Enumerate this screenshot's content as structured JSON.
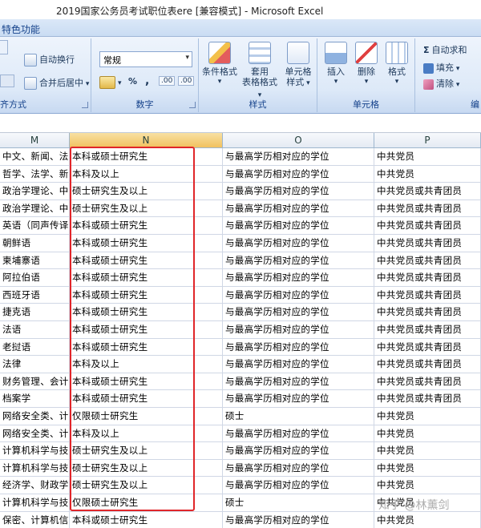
{
  "window": {
    "title": "2019国家公务员考试职位表ere  [兼容模式] - Microsoft Excel"
  },
  "ribbon": {
    "tab_label": "特色功能",
    "alignment": {
      "label": "齐方式",
      "wrap_text": "自动换行",
      "merge_center": "合并后居中"
    },
    "number": {
      "label": "数字",
      "format_value": "常规",
      "percent": "%",
      "comma": ",",
      "inc_decimal": ".00",
      "dec_decimal": ".00"
    },
    "styles": {
      "label": "样式",
      "conditional": [
        "条件格式"
      ],
      "table_format": [
        "套用",
        "表格格式"
      ],
      "cell_styles": [
        "单元格",
        "样式"
      ]
    },
    "cells": {
      "label": "单元格",
      "insert": "插入",
      "delete": "删除",
      "format": "格式"
    },
    "editing": {
      "label": "编",
      "autosum": "自动求和",
      "fill": "填充",
      "clear": "清除"
    }
  },
  "sheet": {
    "columns": [
      "M",
      "N",
      "O",
      "P"
    ],
    "rows": [
      [
        "中文、新闻、法学",
        "本科或硕士研究生",
        "与最高学历相对应的学位",
        "中共党员"
      ],
      [
        "哲学、法学、新闻",
        "本科及以上",
        "与最高学历相对应的学位",
        "中共党员"
      ],
      [
        "政治学理论、中外",
        "硕士研究生及以上",
        "与最高学历相对应的学位",
        "中共党员或共青团员"
      ],
      [
        "政治学理论、中外",
        "硕士研究生及以上",
        "与最高学历相对应的学位",
        "中共党员或共青团员"
      ],
      [
        "英语（同声传译、",
        "本科或硕士研究生",
        "与最高学历相对应的学位",
        "中共党员或共青团员"
      ],
      [
        "朝鲜语",
        "本科或硕士研究生",
        "与最高学历相对应的学位",
        "中共党员或共青团员"
      ],
      [
        "柬埔寨语",
        "本科或硕士研究生",
        "与最高学历相对应的学位",
        "中共党员或共青团员"
      ],
      [
        "阿拉伯语",
        "本科或硕士研究生",
        "与最高学历相对应的学位",
        "中共党员或共青团员"
      ],
      [
        "西班牙语",
        "本科或硕士研究生",
        "与最高学历相对应的学位",
        "中共党员或共青团员"
      ],
      [
        "捷克语",
        "本科或硕士研究生",
        "与最高学历相对应的学位",
        "中共党员或共青团员"
      ],
      [
        "法语",
        "本科或硕士研究生",
        "与最高学历相对应的学位",
        "中共党员或共青团员"
      ],
      [
        "老挝语",
        "本科或硕士研究生",
        "与最高学历相对应的学位",
        "中共党员或共青团员"
      ],
      [
        "法律",
        "本科及以上",
        "与最高学历相对应的学位",
        "中共党员或共青团员"
      ],
      [
        "财务管理、会计学",
        "本科或硕士研究生",
        "与最高学历相对应的学位",
        "中共党员或共青团员"
      ],
      [
        "档案学",
        "本科或硕士研究生",
        "与最高学历相对应的学位",
        "中共党员或共青团员"
      ],
      [
        "网络安全类、计算",
        "仅限硕士研究生",
        "硕士",
        "中共党员"
      ],
      [
        "网络安全类、计算",
        "本科及以上",
        "与最高学历相对应的学位",
        "中共党员"
      ],
      [
        "计算机科学与技术",
        "硕士研究生及以上",
        "与最高学历相对应的学位",
        "中共党员"
      ],
      [
        "计算机科学与技术",
        "硕士研究生及以上",
        "与最高学历相对应的学位",
        "中共党员"
      ],
      [
        "经济学、财政学、",
        "硕士研究生及以上",
        "与最高学历相对应的学位",
        "中共党员"
      ],
      [
        "计算机科学与技术",
        "仅限硕士研究生",
        "硕士",
        "中共党员"
      ],
      [
        "保密、计算机信息",
        "本科或硕士研究生",
        "与最高学历相对应的学位",
        "中共党员"
      ]
    ]
  },
  "watermark": "知乎 @林薰剑",
  "colors": {
    "highlight": "#e0262a",
    "ribbon_text": "#15428b"
  }
}
